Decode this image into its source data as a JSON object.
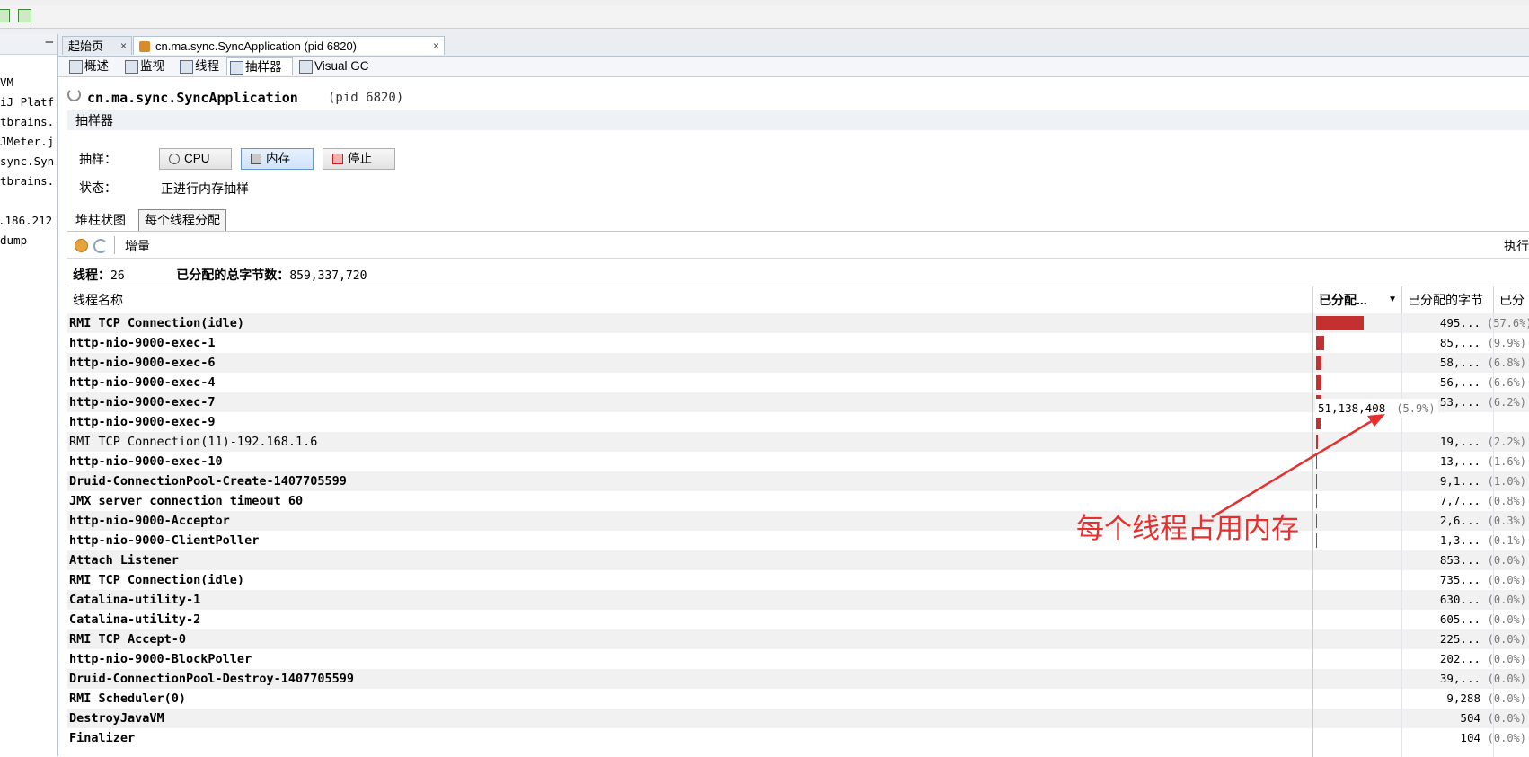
{
  "toolbar": {
    "icons": [
      "add-jmx-icon",
      "add-snapshot-icon"
    ]
  },
  "explorer": {
    "minimize": "—",
    "items": [
      "VM",
      "iJ Platf",
      "tbrains.",
      "JMeter.j",
      "sync.Syn",
      "tbrains.",
      ".186.212",
      "dump"
    ]
  },
  "doc_tabs": {
    "start": "起始页",
    "app": "cn.ma.sync.SyncApplication (pid 6820)",
    "close": "×"
  },
  "view_tabs": [
    "概述",
    "监视",
    "线程",
    "抽样器",
    "Visual GC"
  ],
  "header": {
    "app_name": "cn.ma.sync.SyncApplication",
    "pid": "(pid 6820)"
  },
  "sampler": {
    "section_title": "抽样器",
    "sample_label": "抽样：",
    "status_label": "状态：",
    "status_value": "正进行内存抽样",
    "buttons": {
      "cpu": "CPU",
      "memory": "内存",
      "stop": "停止"
    }
  },
  "sub_tabs": [
    "堆柱状图",
    "每个线程分配"
  ],
  "controls": {
    "delta": "增量",
    "right_cut": "执行"
  },
  "summary": {
    "threads_label": "线程：",
    "threads_value": "26",
    "total_label": "已分配的总字节数：",
    "total_value": "859,337,720"
  },
  "table": {
    "columns": [
      "线程名称",
      "已分配...",
      "已分配的字节",
      "已分"
    ],
    "rows": [
      {
        "name": "RMI TCP Connection(idle)",
        "bytes": "495...",
        "pct": "(57.6%)",
        "share": 57.6,
        "bold": true
      },
      {
        "name": "http-nio-9000-exec-1",
        "bytes": "85,...",
        "pct": "(9.9%)",
        "share": 9.9,
        "bold": true
      },
      {
        "name": "http-nio-9000-exec-6",
        "bytes": "58,...",
        "pct": "(6.8%)",
        "share": 6.8,
        "bold": true
      },
      {
        "name": "http-nio-9000-exec-4",
        "bytes": "56,...",
        "pct": "(6.6%)",
        "share": 6.6,
        "bold": true
      },
      {
        "name": "http-nio-9000-exec-7",
        "bytes": "53,...",
        "pct": "(6.2%)",
        "share": 6.2,
        "bold": true
      },
      {
        "name": "http-nio-9000-exec-9",
        "bytes": "51,138,408",
        "pct": "(5.9%)",
        "share": 5.9,
        "bold": true
      },
      {
        "name": "RMI TCP Connection(11)-192.168.1.6",
        "bytes": "19,...",
        "pct": "(2.2%)",
        "share": 2.2,
        "bold": false
      },
      {
        "name": "http-nio-9000-exec-10",
        "bytes": "13,...",
        "pct": "(1.6%)",
        "share": 1.6,
        "bold": true
      },
      {
        "name": "Druid-ConnectionPool-Create-1407705599",
        "bytes": "9,1...",
        "pct": "(1.0%)",
        "share": 1.0,
        "bold": true
      },
      {
        "name": "JMX server connection timeout 60",
        "bytes": "7,7...",
        "pct": "(0.8%)",
        "share": 0.8,
        "bold": true
      },
      {
        "name": "http-nio-9000-Acceptor",
        "bytes": "2,6...",
        "pct": "(0.3%)",
        "share": 0.3,
        "bold": true
      },
      {
        "name": "http-nio-9000-ClientPoller",
        "bytes": "1,3...",
        "pct": "(0.1%)",
        "share": 0.1,
        "bold": true
      },
      {
        "name": "Attach Listener",
        "bytes": "853...",
        "pct": "(0.0%)",
        "share": 0.0,
        "bold": true
      },
      {
        "name": "RMI TCP Connection(idle)",
        "bytes": "735...",
        "pct": "(0.0%)",
        "share": 0.0,
        "bold": true
      },
      {
        "name": "Catalina-utility-1",
        "bytes": "630...",
        "pct": "(0.0%)",
        "share": 0.0,
        "bold": true
      },
      {
        "name": "Catalina-utility-2",
        "bytes": "605...",
        "pct": "(0.0%)",
        "share": 0.0,
        "bold": true
      },
      {
        "name": "RMI TCP Accept-0",
        "bytes": "225...",
        "pct": "(0.0%)",
        "share": 0.0,
        "bold": true
      },
      {
        "name": "http-nio-9000-BlockPoller",
        "bytes": "202...",
        "pct": "(0.0%)",
        "share": 0.0,
        "bold": true
      },
      {
        "name": "Druid-ConnectionPool-Destroy-1407705599",
        "bytes": "39,...",
        "pct": "(0.0%)",
        "share": 0.0,
        "bold": true
      },
      {
        "name": "RMI Scheduler(0)",
        "bytes": "9,288",
        "pct": "(0.0%)",
        "share": 0.0,
        "bold": true
      },
      {
        "name": "DestroyJavaVM",
        "bytes": "504",
        "pct": "(0.0%)",
        "share": 0.0,
        "bold": true
      },
      {
        "name": "Finalizer",
        "bytes": "104",
        "pct": "(0.0%)",
        "share": 0.0,
        "bold": true
      }
    ]
  },
  "tooltip": {
    "value": "51,138,408",
    "pct": "(5.9%)"
  },
  "annotation": {
    "text": "每个线程占用内存",
    "color": "#e53030"
  },
  "colors": {
    "bar": "#c43030",
    "accent_blue": "#6b93c6"
  }
}
